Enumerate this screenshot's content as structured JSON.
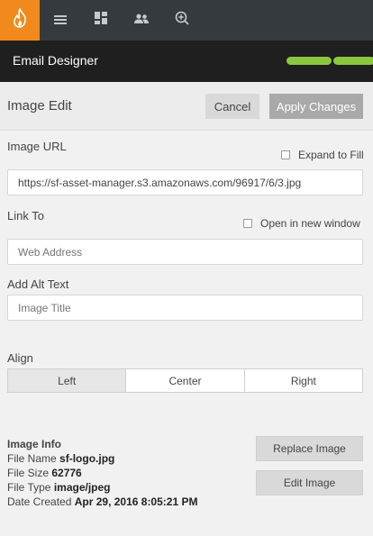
{
  "topnav": {
    "logo_icon": "flame-icon",
    "items": [
      {
        "icon": "menu-icon"
      },
      {
        "icon": "dashboard-icon"
      },
      {
        "icon": "people-icon"
      },
      {
        "icon": "add-search-icon"
      }
    ],
    "accent_color": "#f08a1c"
  },
  "app": {
    "title": "Email Designer"
  },
  "progress": {
    "steps_done": 2,
    "color": "#8cc63f"
  },
  "panel": {
    "title": "Image Edit",
    "cancel_label": "Cancel",
    "apply_label": "Apply Changes"
  },
  "form": {
    "image_url_label": "Image URL",
    "expand_label": "Expand to Fill",
    "image_url_value": "https://sf-asset-manager.s3.amazonaws.com/96917/6/3.jpg",
    "link_to_label": "Link To",
    "new_window_label": "Open in new window",
    "link_placeholder": "Web Address",
    "alt_label": "Add Alt Text",
    "alt_placeholder": "Image Title",
    "align_label": "Align",
    "align_options": [
      "Left",
      "Center",
      "Right"
    ],
    "align_selected": "Left"
  },
  "image_info": {
    "heading": "Image Info",
    "file_name_label": "File Name",
    "file_name": "sf-logo.jpg",
    "file_size_label": "File Size",
    "file_size": "62776",
    "file_type_label": "File Type",
    "file_type": "image/jpeg",
    "date_label": "Date Created",
    "date": "Apr 29, 2016 8:05:21 PM"
  },
  "actions": {
    "replace_label": "Replace Image",
    "edit_label": "Edit Image"
  }
}
